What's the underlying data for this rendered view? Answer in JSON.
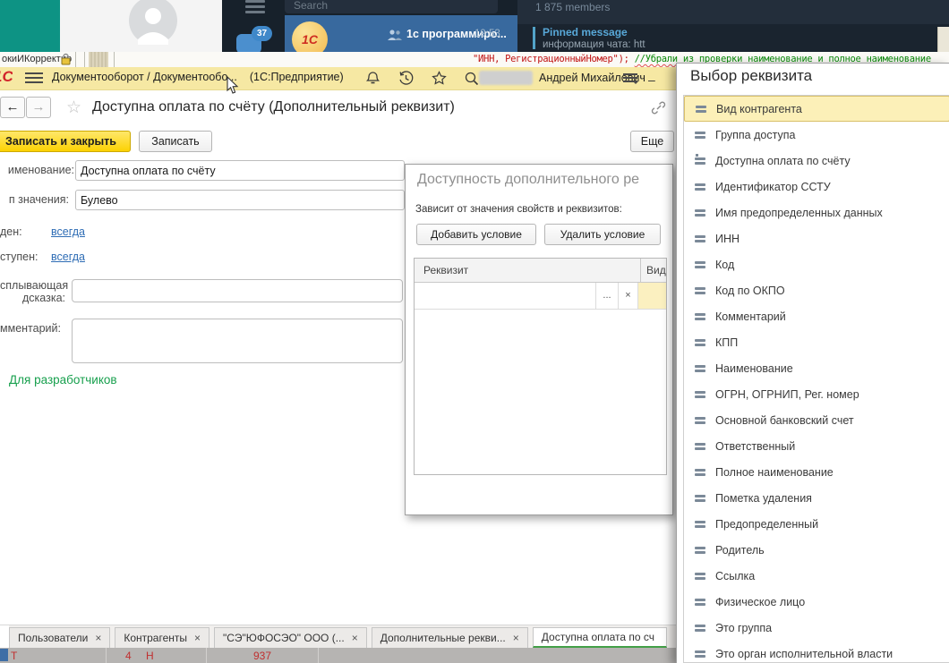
{
  "background": {
    "telegram": {
      "search_placeholder": "Search",
      "chat_badge": "37",
      "chat_avatar_text": "1С",
      "chat_title": "1с программиро...",
      "chat_time": "19:53",
      "members": "1 875 members",
      "pinned_label": "Pinned message",
      "pinned_text": "информация чата: htt",
      "pinned_close": "×"
    },
    "configurator": {
      "module_tab": "окиИКорректир",
      "code_string": "\"ИНН, РегистрационныйНомер\");  ",
      "code_comment": "//Убрали из проверки наименование и полное наименование"
    },
    "bottom_strip": {
      "fragments": [
        "Т",
        "4",
        "Н",
        "937"
      ]
    }
  },
  "app": {
    "titlebar": {
      "breadcrumb": "Документооборот / Документообо...",
      "mode": "(1С:Предприятие)",
      "user": "Андрей Михайлович",
      "minimize": "–"
    },
    "nav": {
      "back": "←",
      "forward": "→",
      "favorite_star": "☆"
    },
    "page_title": "Доступна оплата по счёту (Дополнительный реквизит)",
    "toolbar": {
      "save_close": "Записать и закрыть",
      "save": "Записать",
      "more": "Еще"
    },
    "form": {
      "name_label": "именование:",
      "name_value": "Доступна оплата по счёту",
      "type_label": "п значения:",
      "type_value": "Булево",
      "visible_label": "ден:",
      "visible_value": "всегда",
      "available_label": "ступен:",
      "available_value": "всегда",
      "tooltip_label_line1": "сплывающая",
      "tooltip_label_line2": "дсказка:",
      "comment_label": "мментарий:",
      "developers_link": "Для разработчиков"
    },
    "tabs": [
      {
        "label": "Пользователи",
        "close": "×"
      },
      {
        "label": "Контрагенты",
        "close": "×"
      },
      {
        "label": "\"СЭ\"ЮФОСЭО\" ООО (...",
        "close": "×"
      },
      {
        "label": "Дополнительные рекви...",
        "close": "×"
      },
      {
        "label": "Доступна оплата по сч",
        "active": true
      }
    ]
  },
  "dialog": {
    "title": "Доступность дополнительного ре",
    "depends_label": "Зависит от значения свойств и реквизитов:",
    "add_condition": "Добавить условие",
    "delete_condition": "Удалить условие",
    "col_requisite": "Реквизит",
    "col_kind": "Вид с",
    "row_ellipsis": "...",
    "row_clear": "×"
  },
  "picker": {
    "title": "Выбор реквизита",
    "items": [
      {
        "label": "Вид контрагента",
        "selected": true
      },
      {
        "label": "Группа доступа"
      },
      {
        "label": "Доступна оплата по счёту",
        "variant": "pin"
      },
      {
        "label": "Идентификатор ССТУ"
      },
      {
        "label": "Имя предопределенных данных"
      },
      {
        "label": "ИНН"
      },
      {
        "label": "Код"
      },
      {
        "label": "Код по ОКПО"
      },
      {
        "label": "Комментарий"
      },
      {
        "label": "КПП"
      },
      {
        "label": "Наименование"
      },
      {
        "label": "ОГРН, ОГРНИП, Рег. номер"
      },
      {
        "label": "Основной банковский счет"
      },
      {
        "label": "Ответственный"
      },
      {
        "label": "Полное наименование"
      },
      {
        "label": "Пометка удаления"
      },
      {
        "label": "Предопределенный"
      },
      {
        "label": "Родитель"
      },
      {
        "label": "Ссылка"
      },
      {
        "label": "Физическое лицо"
      },
      {
        "label": "Это группа"
      },
      {
        "label": "Это орган исполнительной власти"
      }
    ]
  }
}
